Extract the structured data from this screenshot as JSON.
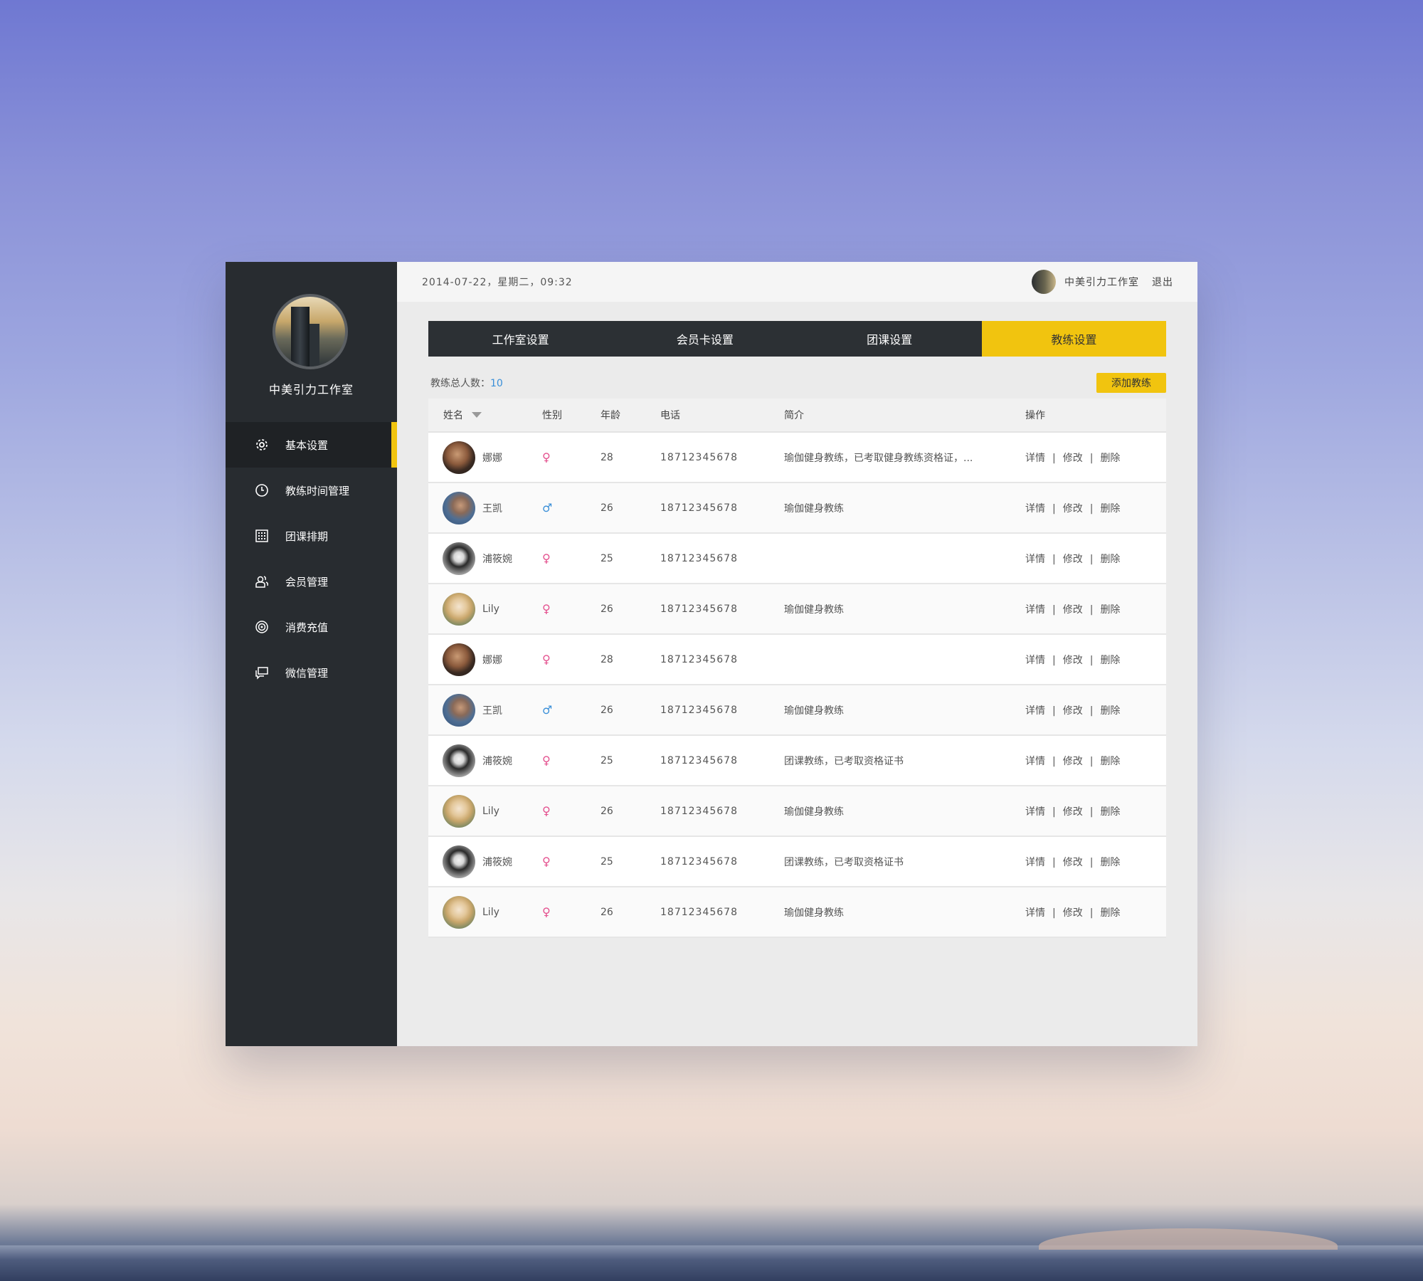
{
  "header": {
    "datetime": "2014-07-22，星期二，09:32",
    "user_name": "中美引力工作室",
    "logout": "退出"
  },
  "sidebar": {
    "studio_name": "中美引力工作室",
    "items": [
      {
        "label": "基本设置",
        "icon": "gear-icon",
        "active": true
      },
      {
        "label": "教练时间管理",
        "icon": "clock-icon",
        "active": false
      },
      {
        "label": "团课排期",
        "icon": "calendar-grid-icon",
        "active": false
      },
      {
        "label": "会员管理",
        "icon": "members-icon",
        "active": false
      },
      {
        "label": "消费充值",
        "icon": "target-icon",
        "active": false
      },
      {
        "label": "微信管理",
        "icon": "chat-icon",
        "active": false
      }
    ]
  },
  "tabs": [
    {
      "label": "工作室设置",
      "active": false
    },
    {
      "label": "会员卡设置",
      "active": false
    },
    {
      "label": "团课设置",
      "active": false
    },
    {
      "label": "教练设置",
      "active": true
    }
  ],
  "summary": {
    "label": "教练总人数：",
    "count": "10"
  },
  "add_button": "添加教练",
  "table": {
    "headers": {
      "name": "姓名",
      "gender": "性别",
      "age": "年龄",
      "phone": "电话",
      "intro": "简介",
      "ops": "操作"
    },
    "ops": {
      "detail": "详情",
      "edit": "修改",
      "delete": "删除",
      "separator": "|"
    },
    "rows": [
      {
        "name": "娜娜",
        "gender": "♀",
        "age": "28",
        "phone": "18712345678",
        "intro": "瑜伽健身教练，已考取健身教练资格证，..."
      },
      {
        "name": "王凯",
        "gender": "♂",
        "age": "26",
        "phone": "18712345678",
        "intro": "瑜伽健身教练"
      },
      {
        "name": "浦筱婉",
        "gender": "♀",
        "age": "25",
        "phone": "18712345678",
        "intro": ""
      },
      {
        "name": "Lily",
        "gender": "♀",
        "age": "26",
        "phone": "18712345678",
        "intro": "瑜伽健身教练"
      },
      {
        "name": "娜娜",
        "gender": "♀",
        "age": "28",
        "phone": "18712345678",
        "intro": ""
      },
      {
        "name": "王凯",
        "gender": "♂",
        "age": "26",
        "phone": "18712345678",
        "intro": "瑜伽健身教练"
      },
      {
        "name": "浦筱婉",
        "gender": "♀",
        "age": "25",
        "phone": "18712345678",
        "intro": "团课教练，已考取资格证书"
      },
      {
        "name": "Lily",
        "gender": "♀",
        "age": "26",
        "phone": "18712345678",
        "intro": "瑜伽健身教练"
      },
      {
        "name": "浦筱婉",
        "gender": "♀",
        "age": "25",
        "phone": "18712345678",
        "intro": "团课教练，已考取资格证书"
      },
      {
        "name": "Lily",
        "gender": "♀",
        "age": "26",
        "phone": "18712345678",
        "intro": "瑜伽健身教练"
      }
    ]
  },
  "colors": {
    "accent": "#f1c40f",
    "sidebar_bg": "#282c30",
    "female": "#e4508e",
    "male": "#3a8fd8",
    "count": "#3a8fd8"
  }
}
